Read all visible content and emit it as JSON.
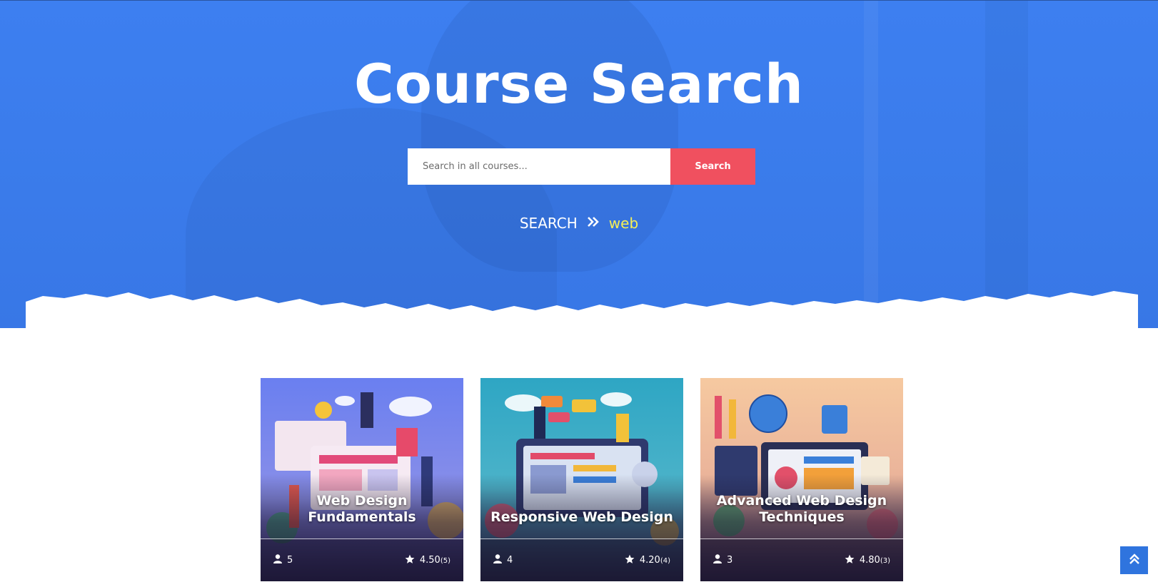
{
  "hero": {
    "title": "Course Search",
    "search": {
      "placeholder": "Search in all courses...",
      "value": "",
      "button_label": "Search"
    },
    "breadcrumb": {
      "root": "SEARCH",
      "separator_icon": "double-chevron-right-icon",
      "current": "web"
    }
  },
  "courses": [
    {
      "title": "Web Design Fundamentals",
      "students": "5",
      "rating": "4.50",
      "rating_count": "(5)"
    },
    {
      "title": "Responsive Web Design",
      "students": "4",
      "rating": "4.20",
      "rating_count": "(4)"
    },
    {
      "title": "Advanced Web Design Techniques",
      "students": "3",
      "rating": "4.80",
      "rating_count": "(3)"
    }
  ],
  "colors": {
    "hero_blue": "#3d7ff0",
    "search_button": "#f0505f",
    "breadcrumb_current": "#f5f056",
    "scroll_top": "#2f74de"
  },
  "icons": {
    "students": "user-icon",
    "rating": "star-icon",
    "scroll_top": "double-chevron-up-icon"
  }
}
